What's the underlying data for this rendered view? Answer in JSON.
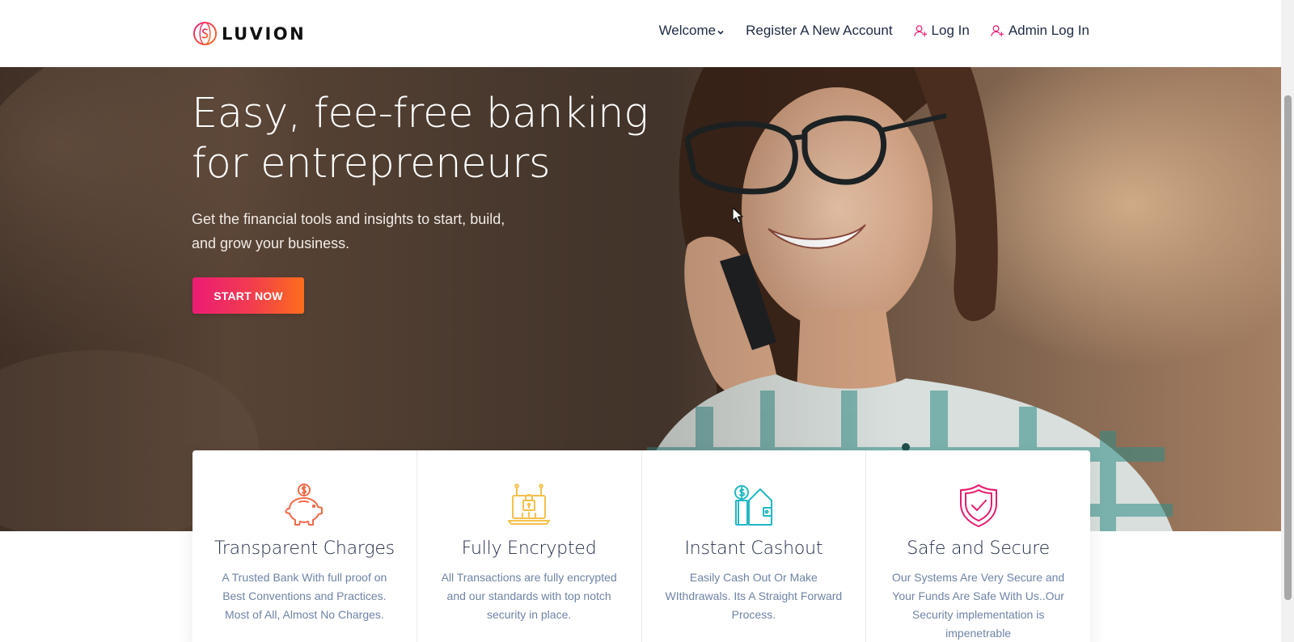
{
  "brand": {
    "name": "LUVION",
    "logo_icon": "globe-dollar-icon"
  },
  "nav": {
    "items": [
      {
        "label": "Welcome",
        "icon": "chevron-down-icon"
      },
      {
        "label": "Register A New Account"
      },
      {
        "label": "Log In",
        "icon": "user-add-icon"
      },
      {
        "label": "Admin Log In",
        "icon": "user-add-icon"
      }
    ]
  },
  "hero": {
    "title_line1": "Easy, fee-free banking",
    "title_line2": "for entrepreneurs",
    "subtitle_line1": "Get the financial tools and insights to start, build,",
    "subtitle_line2": "and grow your business.",
    "cta_label": "START NOW"
  },
  "features": [
    {
      "title": "Transparent Charges",
      "description": "A Trusted Bank With full proof on Best Conventions and Practices. Most of All, Almost No Charges.",
      "icon": "piggy-bank-icon",
      "color": "#f26b4a"
    },
    {
      "title": "Fully Encrypted",
      "description": "All Transactions are fully encrypted and our standards with top notch security in place.",
      "icon": "encrypted-laptop-icon",
      "color": "#f5c04a"
    },
    {
      "title": "Instant Cashout",
      "description": "Easily Cash Out Or Make WIthdrawals. Its A Straight Forward Process.",
      "icon": "wallet-coin-icon",
      "color": "#21b8c4"
    },
    {
      "title": "Safe and Secure",
      "description": "Our Systems Are Very Secure and Your Funds Are Safe With Us..Our Security implementation is impenetrable",
      "icon": "shield-check-icon",
      "color": "#e51c6e"
    }
  ],
  "colors": {
    "accent_pink": "#ec1c74",
    "accent_orange": "#fd6d1b",
    "nav_text": "#1f2a44",
    "feature_text": "#6f83a6"
  }
}
